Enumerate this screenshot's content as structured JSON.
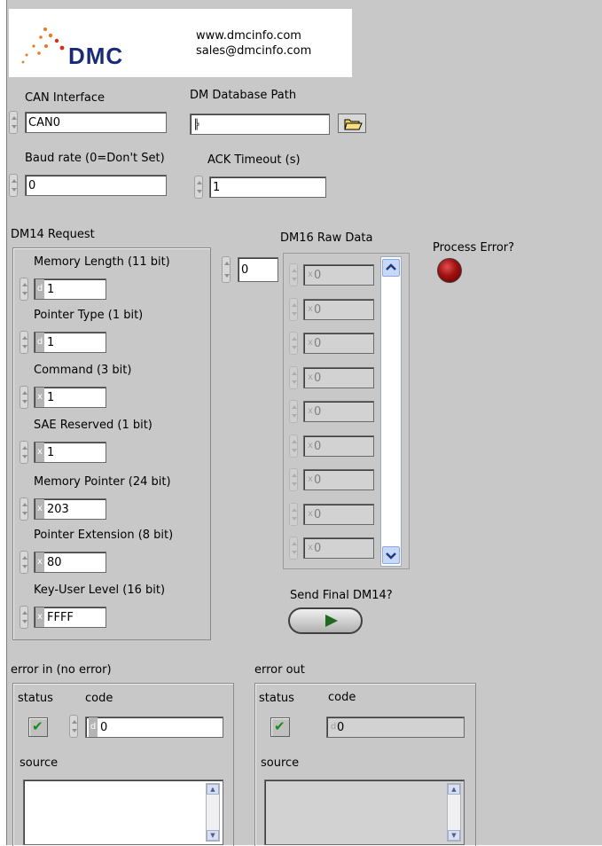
{
  "logo": {
    "brand": "DMC",
    "url": "www.dmcinfo.com",
    "email": "sales@dmcinfo.com"
  },
  "can_interface": {
    "label": "CAN Interface",
    "value": "CAN0"
  },
  "dm_db_path": {
    "label": "DM Database Path",
    "value": ""
  },
  "baud_rate": {
    "label": "Baud rate (0=Don't Set)",
    "value": "0"
  },
  "ack_timeout": {
    "label": "ACK Timeout (s)",
    "value": "1"
  },
  "dm14": {
    "label": "DM14 Request",
    "fields": [
      {
        "label": "Memory Length (11 bit)",
        "radix": "d",
        "value": "1"
      },
      {
        "label": "Pointer Type (1 bit)",
        "radix": "d",
        "value": "1"
      },
      {
        "label": "Command (3 bit)",
        "radix": "x",
        "value": "1"
      },
      {
        "label": "SAE Reserved (1 bit)",
        "radix": "x",
        "value": "1"
      },
      {
        "label": "Memory Pointer (24 bit)",
        "radix": "x",
        "value": "203"
      },
      {
        "label": "Pointer Extension (8 bit)",
        "radix": "x",
        "value": "80"
      },
      {
        "label": "Key-User Level (16 bit)",
        "radix": "x",
        "value": "FFFF"
      }
    ]
  },
  "dm16": {
    "label": "DM16 Raw Data",
    "index": "0",
    "radix": "x",
    "values": [
      "0",
      "0",
      "0",
      "0",
      "0",
      "0",
      "0",
      "0",
      "0"
    ]
  },
  "process_error": {
    "label": "Process Error?",
    "color": "#a01010"
  },
  "send_final": {
    "label": "Send Final DM14?"
  },
  "error_in": {
    "label": "error in (no error)",
    "status_label": "status",
    "code_label": "code",
    "code_radix": "d",
    "code_value": "0",
    "source_label": "source"
  },
  "error_out": {
    "label": "error out",
    "status_label": "status",
    "code_label": "code",
    "code_radix": "d",
    "code_value": "0",
    "source_label": "source"
  }
}
